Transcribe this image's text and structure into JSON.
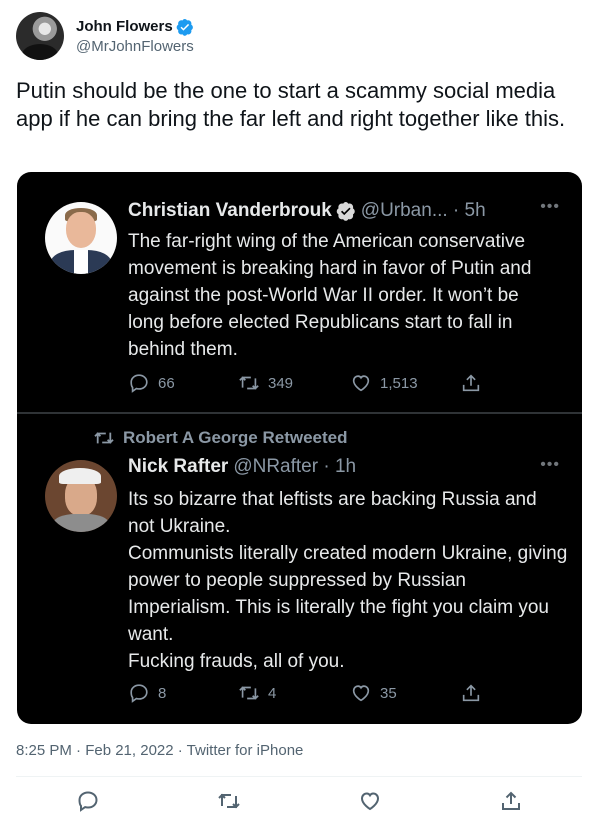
{
  "tweet": {
    "author": {
      "display_name": "John Flowers",
      "handle": "@MrJohnFlowers",
      "verified": true
    },
    "text": "Putin should be the one to start a scammy social media app if he can bring the far left and right together like this.",
    "meta": "8:25 PM · Feb 21, 2022 · Twitter for iPhone"
  },
  "embedded": {
    "tweet1": {
      "name": "Christian Vanderbrouk",
      "handle_time": "@Urban... · 5h",
      "text": "The far-right wing of the American conservative movement is breaking hard in favor of Putin and against the post-World War II order. It won’t be long before elected Republicans start to fall in behind them.",
      "replies": "66",
      "retweets": "349",
      "likes": "1,513"
    },
    "tweet2": {
      "retweeted_by": "Robert A George Retweeted",
      "name": "Nick Rafter",
      "handle_time": "@NRafter · 1h",
      "text": "Its so bizarre that leftists are backing Russia and not Ukraine.\nCommunists literally created modern Ukraine, giving power to people suppressed by Russian Imperialism. This is literally the fight you claim you want.\nFucking frauds, all of you.",
      "replies": "8",
      "retweets": "4",
      "likes": "35"
    }
  },
  "icons": {
    "verified": "verified-badge-icon",
    "more": "more-dots-icon",
    "reply": "reply-icon",
    "retweet": "retweet-icon",
    "like": "heart-icon",
    "share": "share-icon"
  },
  "colors": {
    "verified": "#1d9bf0",
    "embed_bg": "#000000",
    "muted_dark": "#8b98a5",
    "muted_light": "#536471"
  }
}
